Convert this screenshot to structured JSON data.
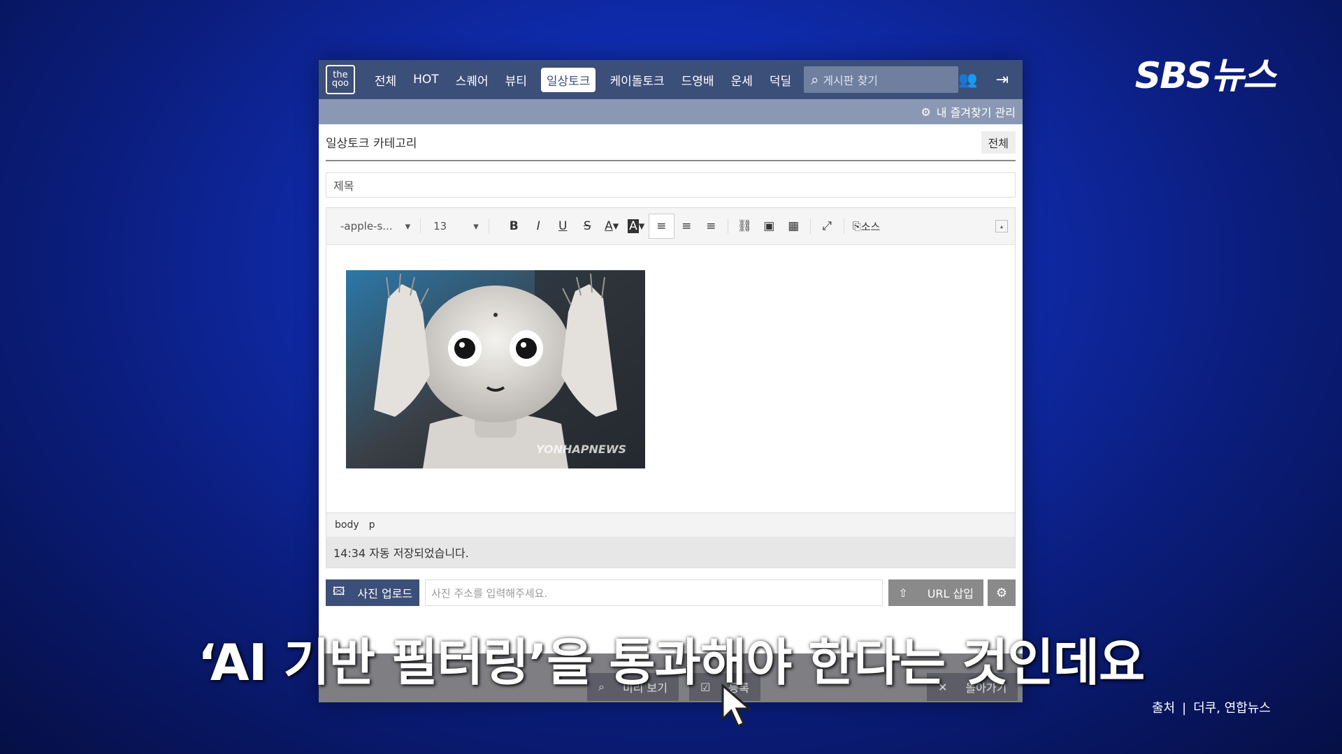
{
  "brand": {
    "logo": "SBS뉴스",
    "source_label": "출처",
    "source_value": "더쿠, 연합뉴스"
  },
  "nav": {
    "logo": "the qoo",
    "items": [
      "전체",
      "HOT",
      "스퀘어",
      "뷰티",
      "일상토크",
      "케이돌토크",
      "드영배",
      "운세",
      "덕딜"
    ],
    "active": "일상토크",
    "search_placeholder": "게시판 찾기"
  },
  "subbar": {
    "favorites": "내 즐겨찾기 관리"
  },
  "form": {
    "category_label": "일상토크 카테고리",
    "category_value": "전체",
    "title_placeholder": "제목",
    "font": "-apple-s...",
    "size": "13",
    "source_btn": "소스",
    "path": [
      "body",
      "p"
    ],
    "autosave": "14:34 자동 저장되었습니다.",
    "upload_btn": "사진 업로드",
    "url_placeholder": "사진 주소를 입력해주세요.",
    "url_insert": "URL 삽입",
    "preview": "미리 보기",
    "submit": "등록",
    "back": "돌아가기",
    "watermark": "YONHAPNEWS"
  },
  "caption": "‘AI 기반 필터링’을 통과해야 한다는 것인데요"
}
